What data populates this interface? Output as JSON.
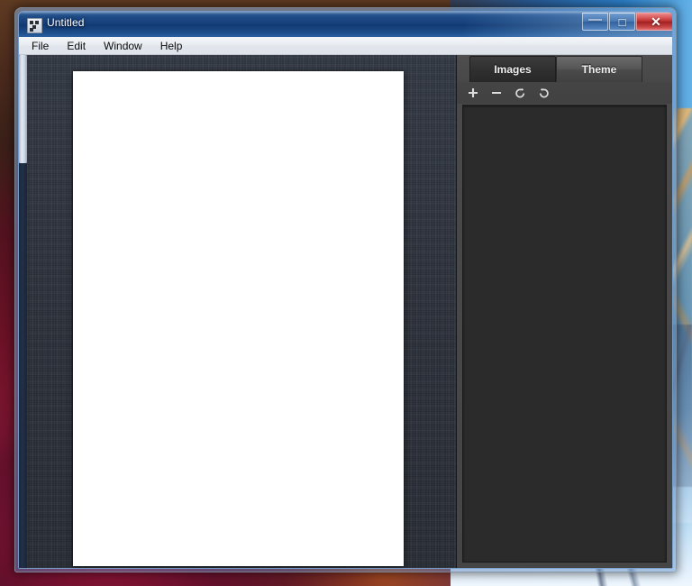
{
  "window": {
    "title": "Untitled",
    "app_icon": "app-icon",
    "controls": {
      "minimize_label": "—",
      "maximize_label": "□",
      "close_label": "✕"
    }
  },
  "menubar": {
    "items": [
      {
        "label": "File"
      },
      {
        "label": "Edit"
      },
      {
        "label": "Window"
      },
      {
        "label": "Help"
      }
    ]
  },
  "canvas": {
    "page_label": "",
    "scrollbar": "vertical-scrollbar"
  },
  "side_panel": {
    "tabs": [
      {
        "label": "Images",
        "selected": true
      },
      {
        "label": "Theme",
        "selected": false
      }
    ],
    "toolbar": [
      {
        "name": "add-icon",
        "glyph": "+"
      },
      {
        "name": "remove-icon",
        "glyph": "−"
      },
      {
        "name": "rotate-left-icon",
        "glyph": "↺"
      },
      {
        "name": "rotate-right-icon",
        "glyph": "↻"
      }
    ],
    "list_items": []
  },
  "colors": {
    "titlebar_blue": "#17407a",
    "close_red": "#b62b2b",
    "panel_dark": "#2b2b2b",
    "panel_gray": "#454545",
    "canvas_bg": "#2d323c",
    "page_white": "#ffffff"
  }
}
